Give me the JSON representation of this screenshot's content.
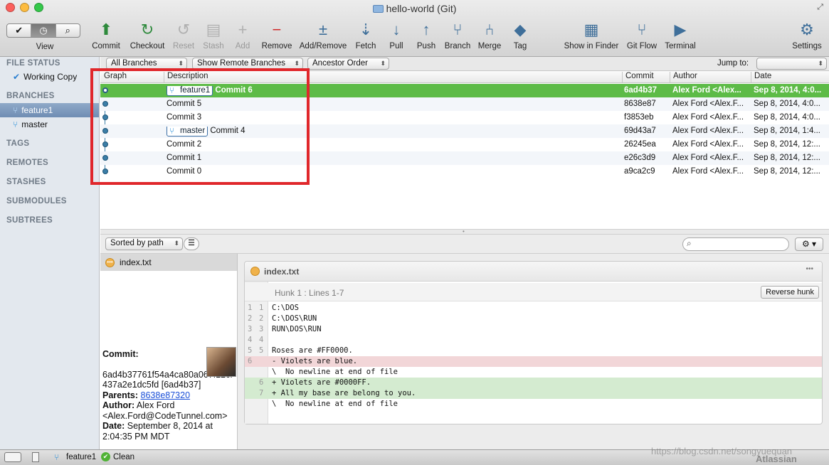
{
  "window": {
    "title": "hello-world (Git)"
  },
  "toolbar": {
    "view_label": "View",
    "buttons": [
      {
        "label": "Commit",
        "icon": "commit-icon",
        "enabled": true
      },
      {
        "label": "Checkout",
        "icon": "checkout-icon",
        "enabled": true
      },
      {
        "label": "Reset",
        "icon": "reset-icon",
        "enabled": false
      },
      {
        "label": "Stash",
        "icon": "stash-icon",
        "enabled": false
      },
      {
        "label": "Add",
        "icon": "add-icon",
        "enabled": false
      },
      {
        "label": "Remove",
        "icon": "remove-icon",
        "enabled": true
      },
      {
        "label": "Add/Remove",
        "icon": "add-remove-icon",
        "enabled": true
      },
      {
        "label": "Fetch",
        "icon": "fetch-icon",
        "enabled": true
      },
      {
        "label": "Pull",
        "icon": "pull-icon",
        "enabled": true
      },
      {
        "label": "Push",
        "icon": "push-icon",
        "enabled": true
      },
      {
        "label": "Branch",
        "icon": "branch-icon",
        "enabled": true
      },
      {
        "label": "Merge",
        "icon": "merge-icon",
        "enabled": true
      },
      {
        "label": "Tag",
        "icon": "tag-icon",
        "enabled": true
      },
      {
        "label": "Show in Finder",
        "icon": "finder-icon",
        "enabled": true
      },
      {
        "label": "Git Flow",
        "icon": "git-flow-icon",
        "enabled": true
      },
      {
        "label": "Terminal",
        "icon": "terminal-icon",
        "enabled": true
      },
      {
        "label": "Settings",
        "icon": "gear-icon",
        "enabled": true
      }
    ]
  },
  "sidebar": {
    "file_status": "FILE STATUS",
    "working_copy": "Working Copy",
    "branches": "BRANCHES",
    "branch_items": [
      "feature1",
      "master"
    ],
    "tags": "TAGS",
    "remotes": "REMOTES",
    "stashes": "STASHES",
    "submodules": "SUBMODULES",
    "subtrees": "SUBTREES"
  },
  "filters": {
    "branches": "All Branches",
    "remote": "Show Remote Branches",
    "order": "Ancestor Order",
    "jump_to": "Jump to:"
  },
  "columns": {
    "graph": "Graph",
    "description": "Description",
    "commit": "Commit",
    "author": "Author",
    "date": "Date"
  },
  "commits": [
    {
      "tag": "feature1",
      "description": "Commit 6",
      "hash": "6ad4b37",
      "author": "Alex Ford <Alex...",
      "date": "Sep 8, 2014, 4:0...",
      "selected": true
    },
    {
      "tag": "",
      "description": "Commit 5",
      "hash": "8638e87",
      "author": "Alex Ford <Alex.F...",
      "date": "Sep 8, 2014, 4:0...",
      "selected": false
    },
    {
      "tag": "",
      "description": "Commit 3",
      "hash": "f3853eb",
      "author": "Alex Ford <Alex.F...",
      "date": "Sep 8, 2014, 4:0...",
      "selected": false
    },
    {
      "tag": "master",
      "description": "Commit 4",
      "hash": "69d43a7",
      "author": "Alex Ford <Alex.F...",
      "date": "Sep 8, 2014, 1:4...",
      "selected": false
    },
    {
      "tag": "",
      "description": "Commit 2",
      "hash": "26245ea",
      "author": "Alex Ford <Alex.F...",
      "date": "Sep 8, 2014, 12:...",
      "selected": false
    },
    {
      "tag": "",
      "description": "Commit 1",
      "hash": "e26c3d9",
      "author": "Alex Ford <Alex.F...",
      "date": "Sep 8, 2014, 12:...",
      "selected": false
    },
    {
      "tag": "",
      "description": "Commit 0",
      "hash": "a9ca2c9",
      "author": "Alex Ford <Alex.F...",
      "date": "Sep 8, 2014, 12:...",
      "selected": false
    }
  ],
  "lower": {
    "sort": "Sorted by path",
    "search_placeholder": ""
  },
  "files": [
    "index.txt"
  ],
  "details": {
    "commit_label": "Commit:",
    "commit_full": "6ad4b37761f54a4ca80a067f12cf437a2e1dc5fd [6ad4b37]",
    "parents_label": "Parents:",
    "parents": "8638e87320",
    "author_label": "Author:",
    "author_name": "Alex Ford",
    "author_email": "<Alex.Ford@CodeTunnel.com>",
    "date_label": "Date:",
    "date": "September 8, 2014 at 2:04:35 PM MDT"
  },
  "diff": {
    "file": "index.txt",
    "hunk": "Hunk 1 : Lines 1-7",
    "reverse": "Reverse hunk",
    "more": "•••",
    "lines": [
      {
        "n1": "1",
        "n2": "1",
        "text": "C:\\DOS",
        "type": "ctx"
      },
      {
        "n1": "2",
        "n2": "2",
        "text": "C:\\DOS\\RUN",
        "type": "ctx"
      },
      {
        "n1": "3",
        "n2": "3",
        "text": "RUN\\DOS\\RUN",
        "type": "ctx"
      },
      {
        "n1": "4",
        "n2": "4",
        "text": "",
        "type": "ctx"
      },
      {
        "n1": "5",
        "n2": "5",
        "text": "Roses are #FF0000.",
        "type": "ctx"
      },
      {
        "n1": "6",
        "n2": "",
        "text": "- Violets are blue.",
        "type": "rem"
      },
      {
        "n1": "",
        "n2": "",
        "text": "\\  No newline at end of file",
        "type": "ctx"
      },
      {
        "n1": "",
        "n2": "6",
        "text": "+ Violets are #0000FF.",
        "type": "add"
      },
      {
        "n1": "",
        "n2": "7",
        "text": "+ All my base are belong to you.",
        "type": "add"
      },
      {
        "n1": "",
        "n2": "",
        "text": "\\  No newline at end of file",
        "type": "ctx"
      }
    ]
  },
  "status": {
    "branch": "feature1",
    "state": "Clean",
    "watermark": "https://blog.csdn.net/songyuequan",
    "brand": "Atlassian"
  },
  "colors": {
    "selected_row": "#5dbb47",
    "highlight_box": "#e0272b",
    "graph_line": "#3b7ea7"
  }
}
